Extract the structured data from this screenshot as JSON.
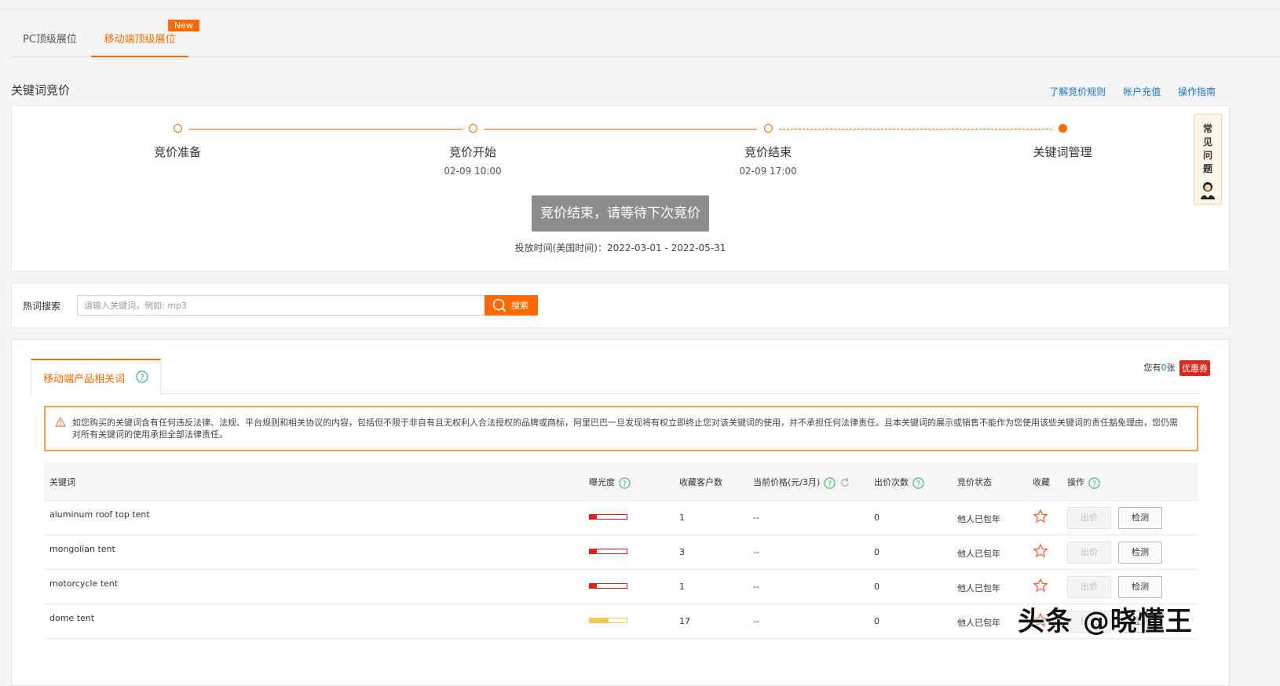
{
  "tabs": {
    "pc": "PC顶级展位",
    "mobile": "移动端顶级展位",
    "new_badge": "New"
  },
  "section": {
    "title": "关键词竞价",
    "links": [
      "了解竞价规则",
      "帐户充值",
      "操作指南"
    ]
  },
  "steps": [
    {
      "label": "竞价准备",
      "time": ""
    },
    {
      "label": "竞价开始",
      "time": "02-09 10:00"
    },
    {
      "label": "竞价结束",
      "time": "02-09 17:00"
    },
    {
      "label": "关键词管理",
      "time": ""
    }
  ],
  "bid_status_button": "竞价结束，请等待下次竞价",
  "period": "投放时间(美国时间)：2022-03-01 - 2022-05-31",
  "faq": {
    "chars": [
      "常",
      "见",
      "问",
      "题"
    ]
  },
  "search": {
    "label": "热词搜索",
    "placeholder": "请输入关键词，例如: mp3",
    "button": "搜索"
  },
  "keywords_panel": {
    "tab_label": "移动端产品相关词",
    "coupon_prefix": "您有",
    "coupon_count": "0",
    "coupon_suffix": "张",
    "coupon_badge": "优惠券",
    "warning": "如您购买的关键词含有任何违反法律、法规、平台规则和相关协议的内容，包括但不限于非自有且无权利人合法授权的品牌或商标，阿里巴巴一旦发现将有权立即终止您对该关键词的使用，并不承担任何法律责任。且本关键词的展示或销售不能作为您使用该些关键词的责任豁免理由，您仍需对所有关键词的使用承担全部法律责任。"
  },
  "table": {
    "headers": {
      "keyword": "关键词",
      "exposure": "曝光度",
      "favorites": "收藏客户数",
      "price": "当前价格(元/3月)",
      "bids": "出价次数",
      "status": "竞价状态",
      "collect": "收藏",
      "action": "操作"
    },
    "bid_button": "出价",
    "check_button": "检测",
    "rows": [
      {
        "keyword": "aluminum roof top tent",
        "exposure": 0.2,
        "level": "low",
        "favorites": "1",
        "price": "--",
        "bids": "0",
        "status": "他人已包年"
      },
      {
        "keyword": "mongolian tent",
        "exposure": 0.2,
        "level": "low",
        "favorites": "3",
        "price": "--",
        "bids": "0",
        "status": "他人已包年"
      },
      {
        "keyword": "motorcycle tent",
        "exposure": 0.2,
        "level": "low",
        "favorites": "1",
        "price": "--",
        "bids": "0",
        "status": "他人已包年"
      },
      {
        "keyword": "dome tent",
        "exposure": 0.5,
        "level": "mid",
        "favorites": "17",
        "price": "--",
        "bids": "0",
        "status": "他人已包年"
      }
    ]
  },
  "watermark": "头条 @晓懂王",
  "colors": {
    "accent": "#ff6a00",
    "link": "#1a73c9",
    "low": "#e02020",
    "mid": "#f3c65b"
  }
}
